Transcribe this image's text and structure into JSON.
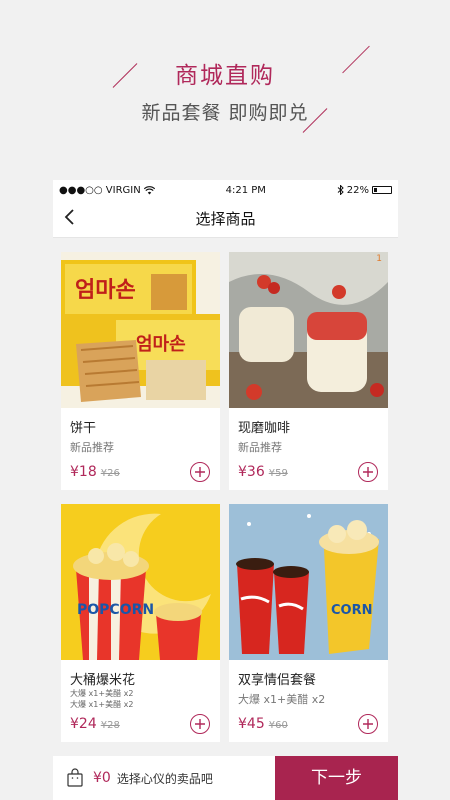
{
  "promo": {
    "title": "商城直购",
    "subtitle": "新品套餐  即购即兑"
  },
  "status_bar": {
    "carrier": "●●●○○ VIRGIN",
    "time": "4:21 PM",
    "battery": "22%"
  },
  "nav": {
    "title": "选择商品"
  },
  "products": [
    {
      "name": "饼干",
      "desc": "新品推荐",
      "desc_lines": [],
      "price": "¥18",
      "old_price": "¥26",
      "badge": ""
    },
    {
      "name": "现磨咖啡",
      "desc": "新品推荐",
      "desc_lines": [],
      "price": "¥36",
      "old_price": "¥59",
      "badge": "1"
    },
    {
      "name": "大桶爆米花",
      "desc": "",
      "desc_lines": [
        "大爆 x1+美醋 x2",
        "大爆 x1+美醋 x2"
      ],
      "price": "¥24",
      "old_price": "¥28",
      "badge": ""
    },
    {
      "name": "双享情侣套餐",
      "desc": "大爆 x1+美醋 x2",
      "desc_lines": [],
      "price": "¥45",
      "old_price": "¥60",
      "badge": ""
    }
  ],
  "cart": {
    "total": "¥0",
    "hint": "选择心仪的卖品吧",
    "next_label": "下一步"
  },
  "colors": {
    "accent": "#b0285a",
    "button": "#a8244f"
  }
}
